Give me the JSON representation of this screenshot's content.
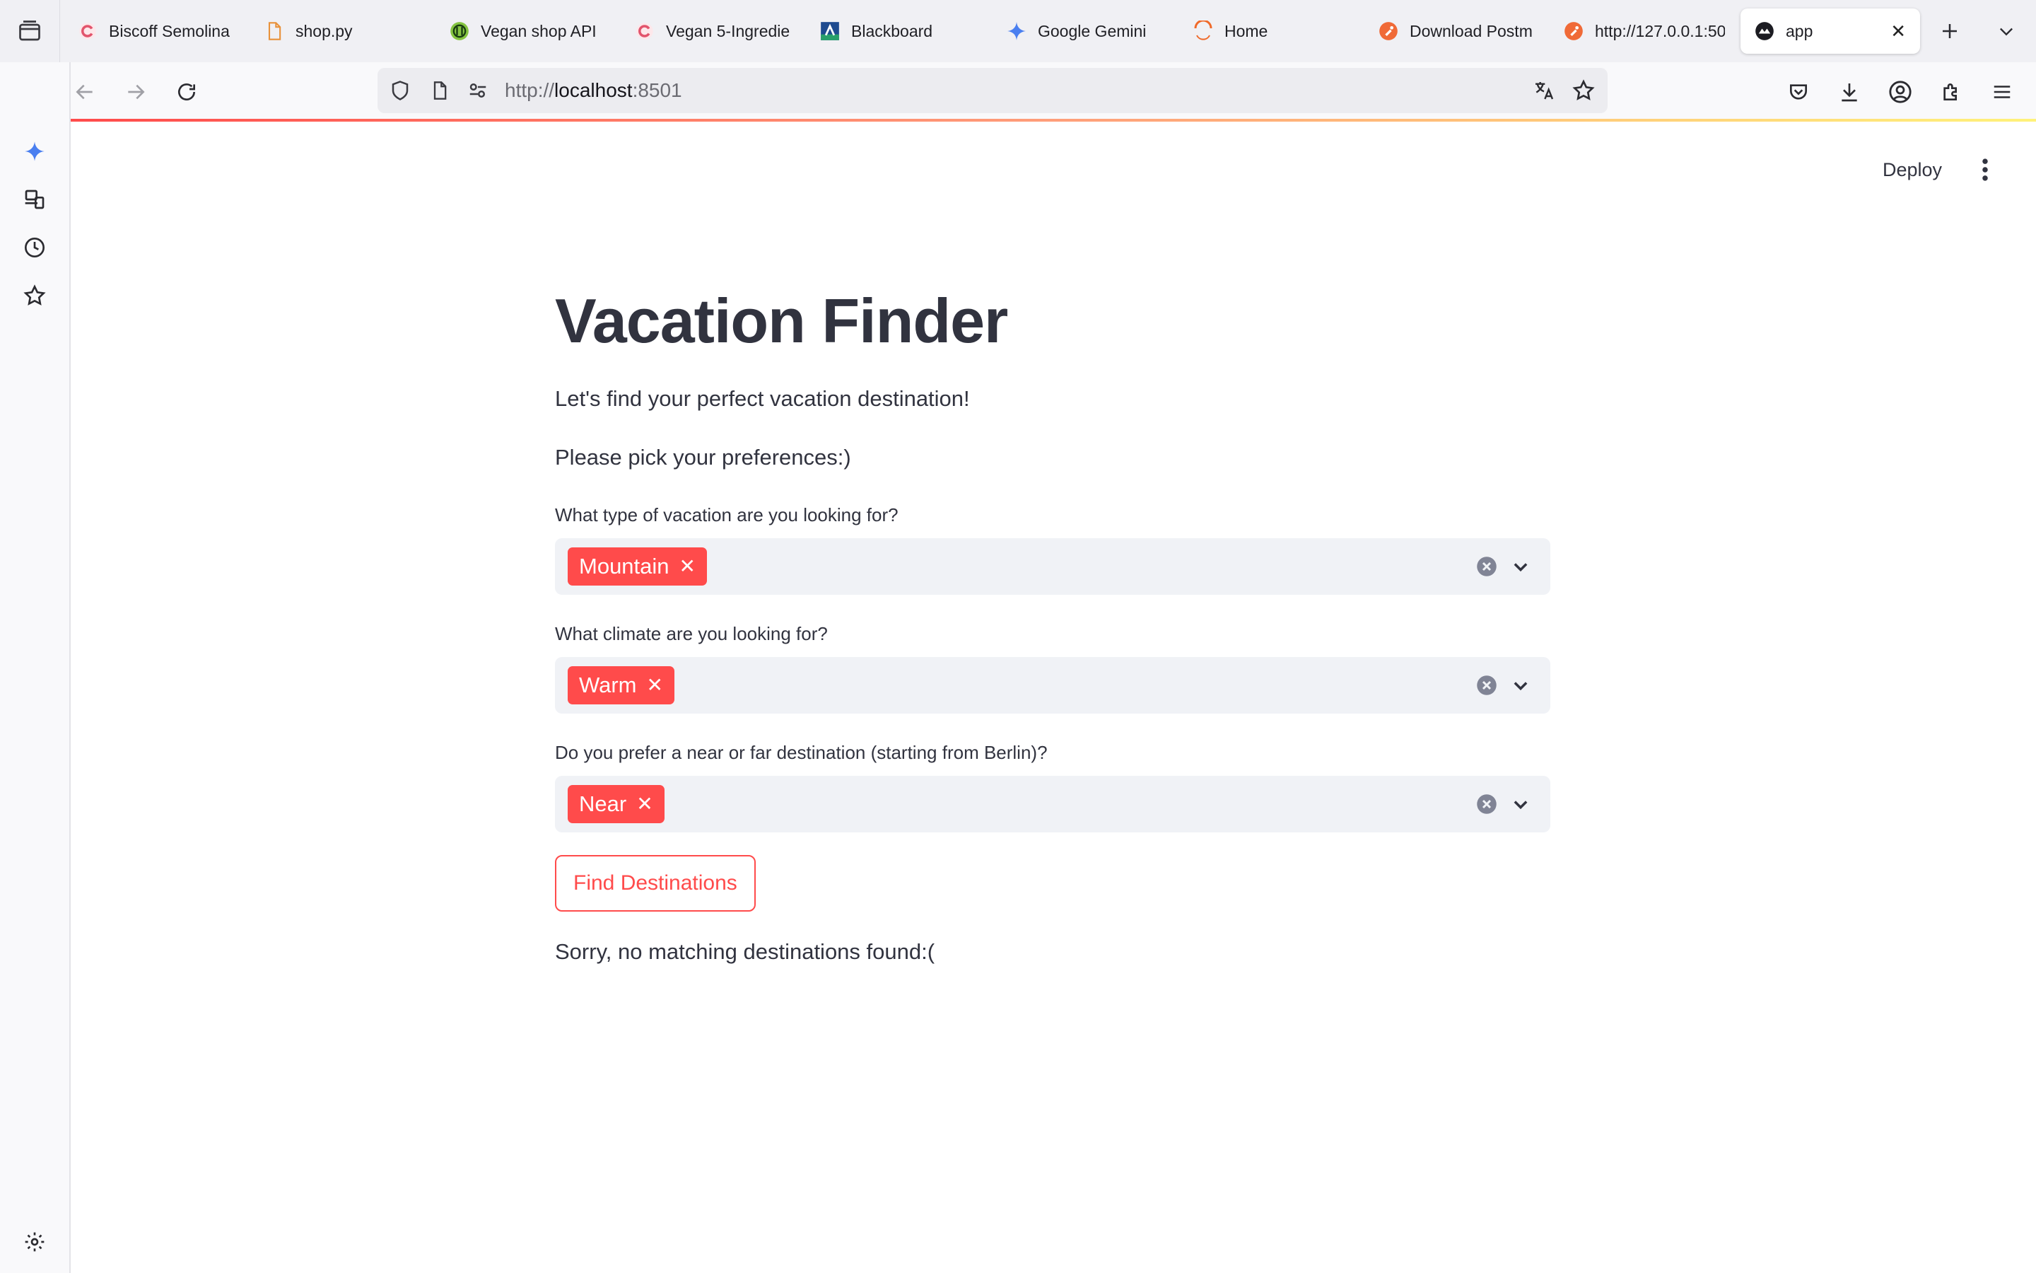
{
  "browser": {
    "tabs": [
      {
        "label": "Biscoff Semolina",
        "icon": "recipe-site-icon"
      },
      {
        "label": "shop.py",
        "icon": "file-icon"
      },
      {
        "label": "Vegan shop API",
        "icon": "api-globe-icon"
      },
      {
        "label": "Vegan 5-Ingredie",
        "icon": "recipe-site-icon"
      },
      {
        "label": "Blackboard",
        "icon": "blackboard-icon"
      },
      {
        "label": "Google Gemini",
        "icon": "gemini-icon"
      },
      {
        "label": "Home",
        "icon": "home-arc-icon"
      },
      {
        "label": "Download Postm",
        "icon": "postman-icon"
      },
      {
        "label": "http://127.0.0.1:50",
        "icon": "postman-icon"
      },
      {
        "label": "app",
        "icon": "streamlit-icon",
        "active": true
      }
    ],
    "url_scheme": "http://",
    "url_host": "localhost",
    "url_port": ":8501"
  },
  "app": {
    "deploy_label": "Deploy",
    "title": "Vacation Finder",
    "intro": "Let's find your perfect vacation destination!",
    "prompt": "Please pick your preferences:)",
    "fields": [
      {
        "label": "What type of vacation are you looking for?",
        "selected": "Mountain"
      },
      {
        "label": "What climate are you looking for?",
        "selected": "Warm"
      },
      {
        "label": "Do you prefer a near or far destination (starting from Berlin)?",
        "selected": "Near"
      }
    ],
    "button_label": "Find Destinations",
    "result": "Sorry, no matching destinations found:("
  },
  "colors": {
    "accent": "#ff4b4b",
    "text": "#31333f",
    "input_bg": "#f0f2f6"
  }
}
